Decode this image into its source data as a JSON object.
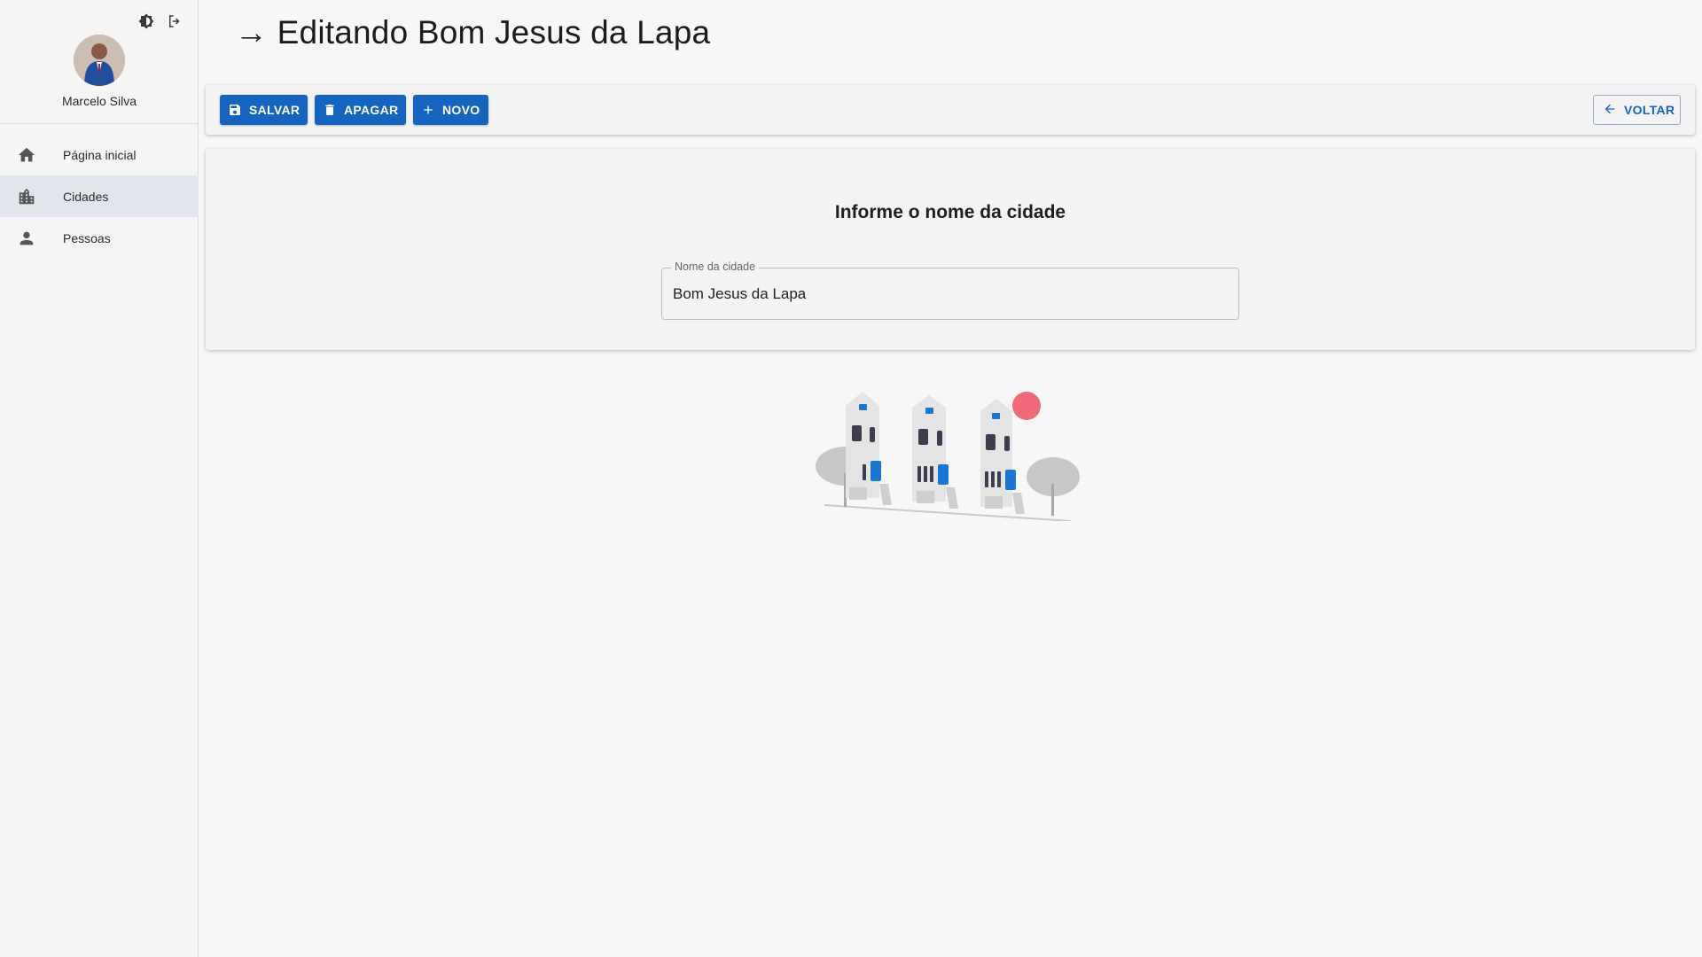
{
  "sidebar": {
    "user": {
      "name": "Marcelo Silva"
    },
    "top_icons": [
      "brightness-icon",
      "logout-icon"
    ],
    "items": [
      {
        "label": "Página inicial",
        "icon": "home-icon",
        "active": false
      },
      {
        "label": "Cidades",
        "icon": "city-icon",
        "active": true
      },
      {
        "label": "Pessoas",
        "icon": "person-icon",
        "active": false
      }
    ]
  },
  "header": {
    "title": "→ Editando Bom Jesus da Lapa"
  },
  "toolbar": {
    "save_label": "SALVAR",
    "delete_label": "APAGAR",
    "new_label": "NOVO",
    "back_label": "VOLTAR"
  },
  "form": {
    "heading": "Informe o nome da cidade",
    "city_field": {
      "label": "Nome da cidade",
      "value": "Bom Jesus da Lapa"
    }
  },
  "colors": {
    "primary": "#1565c0",
    "accent": "#f06a7a",
    "active_nav": "#e2e6ec"
  }
}
